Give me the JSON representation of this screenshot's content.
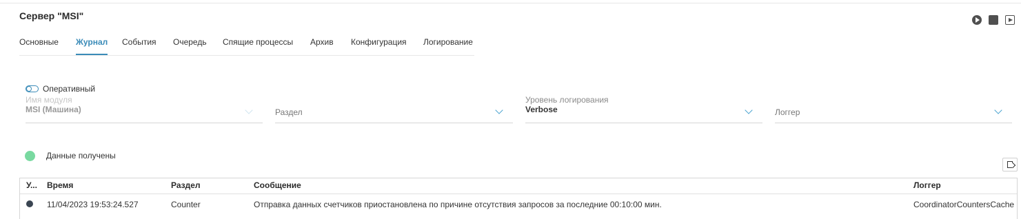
{
  "server": {
    "title": "Сервер \"MSI\""
  },
  "controls": [
    "play-icon",
    "stop-icon",
    "step-icon"
  ],
  "tabs": [
    {
      "label": "Основные"
    },
    {
      "label": "Журнал"
    },
    {
      "label": "События"
    },
    {
      "label": "Очередь"
    },
    {
      "label": "Спящие процессы"
    },
    {
      "label": "Архив"
    },
    {
      "label": "Конфигурация"
    },
    {
      "label": "Логирование"
    }
  ],
  "active_tab": "Журнал",
  "filters": {
    "operative_label": "Оперативный",
    "module": {
      "label": "Имя модуля",
      "value": "MSI (Машина)"
    },
    "section": {
      "placeholder": "Раздел"
    },
    "level": {
      "label": "Уровень логирования",
      "value": "Verbose"
    },
    "logger": {
      "placeholder": "Логгер"
    }
  },
  "status": {
    "text": "Данные получены",
    "color": "#79d9a0"
  },
  "accent_color": "#3a8bb8",
  "table": {
    "headers": [
      "У...",
      "Время",
      "Раздел",
      "Сообщение",
      "Логгер"
    ],
    "rows": [
      {
        "time": "11/04/2023 19:53:24.527",
        "section": "Counter",
        "message": "Отправка данных счетчиков приостановлена по причине отсутствия запросов за последние 00:10:00 мин.",
        "logger": "CoordinatorCountersCache"
      }
    ]
  }
}
